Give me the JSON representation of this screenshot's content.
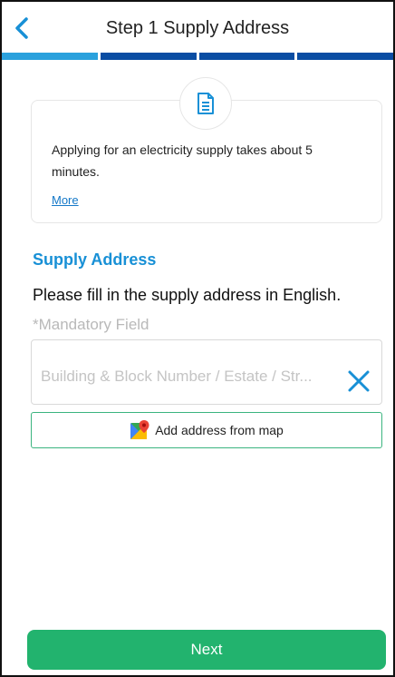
{
  "header": {
    "title": "Step 1  Supply Address"
  },
  "progress": {
    "total_steps": 4,
    "current_step": 1
  },
  "info_card": {
    "text": "Applying for an electricity supply takes about 5 minutes.",
    "more_link": "More",
    "icon": "document-icon"
  },
  "supply_address": {
    "section_title": "Supply Address",
    "instruction": "Please fill in the supply address in English.",
    "mandatory_note": "*Mandatory Field",
    "field": {
      "value": "",
      "placeholder": "Building & Block Number / Estate / Str..."
    },
    "map_button_label": "Add address from map"
  },
  "footer": {
    "next_label": "Next"
  },
  "colors": {
    "accent_blue": "#1890d6",
    "progress_active": "#2aa1dd",
    "progress_inactive": "#0a4da3",
    "primary_green": "#22b36e"
  }
}
